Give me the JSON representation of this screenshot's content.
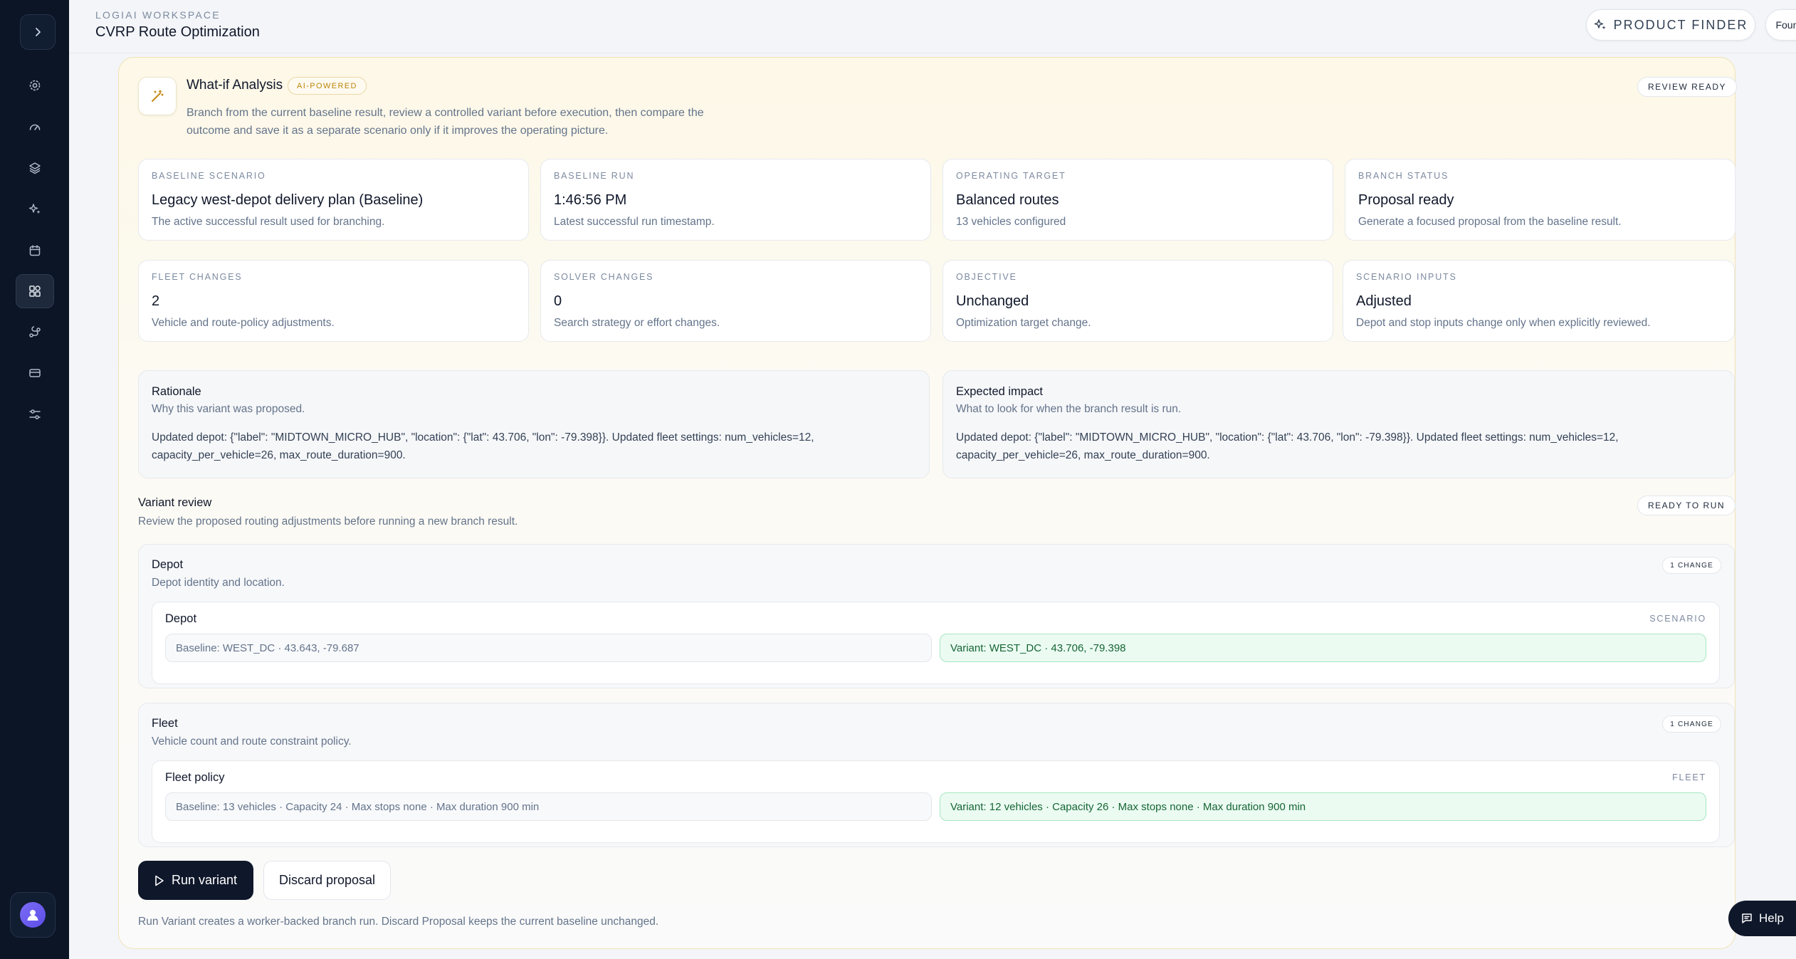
{
  "header": {
    "workspace_label": "LOGIAI WORKSPACE",
    "page_title": "CVRP Route Optimization",
    "product_finder_label": "PRODUCT FINDER",
    "account_label": "Founder account"
  },
  "sidebar": {
    "items": [
      {
        "name": "settings-icon"
      },
      {
        "name": "gauge-icon"
      },
      {
        "name": "layers-icon"
      },
      {
        "name": "sparkles-icon"
      },
      {
        "name": "calendar-icon"
      },
      {
        "name": "shapes-icon",
        "active": true
      },
      {
        "name": "route-icon"
      },
      {
        "name": "credit-card-icon"
      },
      {
        "name": "sliders-icon"
      }
    ]
  },
  "analysis": {
    "title": "What-if Analysis",
    "badge": "AI-POWERED",
    "description": "Branch from the current baseline result, review a controlled variant before execution, then compare the outcome and save it as a separate scenario only if it improves the operating picture.",
    "status_pill": "REVIEW READY"
  },
  "stats": [
    {
      "label": "BASELINE SCENARIO",
      "value": "Legacy west-depot delivery plan (Baseline)",
      "sub": "The active successful result used for branching."
    },
    {
      "label": "BASELINE RUN",
      "value": "1:46:56 PM",
      "sub": "Latest successful run timestamp."
    },
    {
      "label": "OPERATING TARGET",
      "value": "Balanced routes",
      "sub": "13 vehicles configured"
    },
    {
      "label": "BRANCH STATUS",
      "value": "Proposal ready",
      "sub": "Generate a focused proposal from the baseline result."
    },
    {
      "label": "FLEET CHANGES",
      "value": "2",
      "sub": "Vehicle and route-policy adjustments."
    },
    {
      "label": "SOLVER CHANGES",
      "value": "0",
      "sub": "Search strategy or effort changes."
    },
    {
      "label": "OBJECTIVE",
      "value": "Unchanged",
      "sub": "Optimization target change."
    },
    {
      "label": "SCENARIO INPUTS",
      "value": "Adjusted",
      "sub": "Depot and stop inputs change only when explicitly reviewed."
    }
  ],
  "rationale": {
    "title": "Rationale",
    "subtitle": "Why this variant was proposed.",
    "body": "Updated depot: {\"label\": \"MIDTOWN_MICRO_HUB\", \"location\": {\"lat\": 43.706, \"lon\": -79.398}}. Updated fleet settings: num_vehicles=12, capacity_per_vehicle=26, max_route_duration=900."
  },
  "impact": {
    "title": "Expected impact",
    "subtitle": "What to look for when the branch result is run.",
    "body": "Updated depot: {\"label\": \"MIDTOWN_MICRO_HUB\", \"location\": {\"lat\": 43.706, \"lon\": -79.398}}. Updated fleet settings: num_vehicles=12, capacity_per_vehicle=26, max_route_duration=900."
  },
  "variant_review": {
    "title": "Variant review",
    "subtitle": "Review the proposed routing adjustments before running a new branch result.",
    "status_pill": "READY TO RUN",
    "groups": [
      {
        "title": "Depot",
        "subtitle": "Depot identity and location.",
        "change_pill": "1 CHANGE",
        "item_title": "Depot",
        "item_tag": "SCENARIO",
        "baseline": "Baseline: WEST_DC · 43.643, -79.687",
        "variant": "Variant: WEST_DC · 43.706, -79.398"
      },
      {
        "title": "Fleet",
        "subtitle": "Vehicle count and route constraint policy.",
        "change_pill": "1 CHANGE",
        "item_title": "Fleet policy",
        "item_tag": "FLEET",
        "baseline": "Baseline: 13 vehicles · Capacity 24 · Max stops none · Max duration 900 min",
        "variant": "Variant: 12 vehicles · Capacity 26 · Max stops none · Max duration 900 min"
      }
    ]
  },
  "actions": {
    "run_label": "Run variant",
    "discard_label": "Discard proposal",
    "footnote": "Run Variant creates a worker-backed branch run. Discard Proposal keeps the current baseline unchanged."
  },
  "help_label": "Help"
}
